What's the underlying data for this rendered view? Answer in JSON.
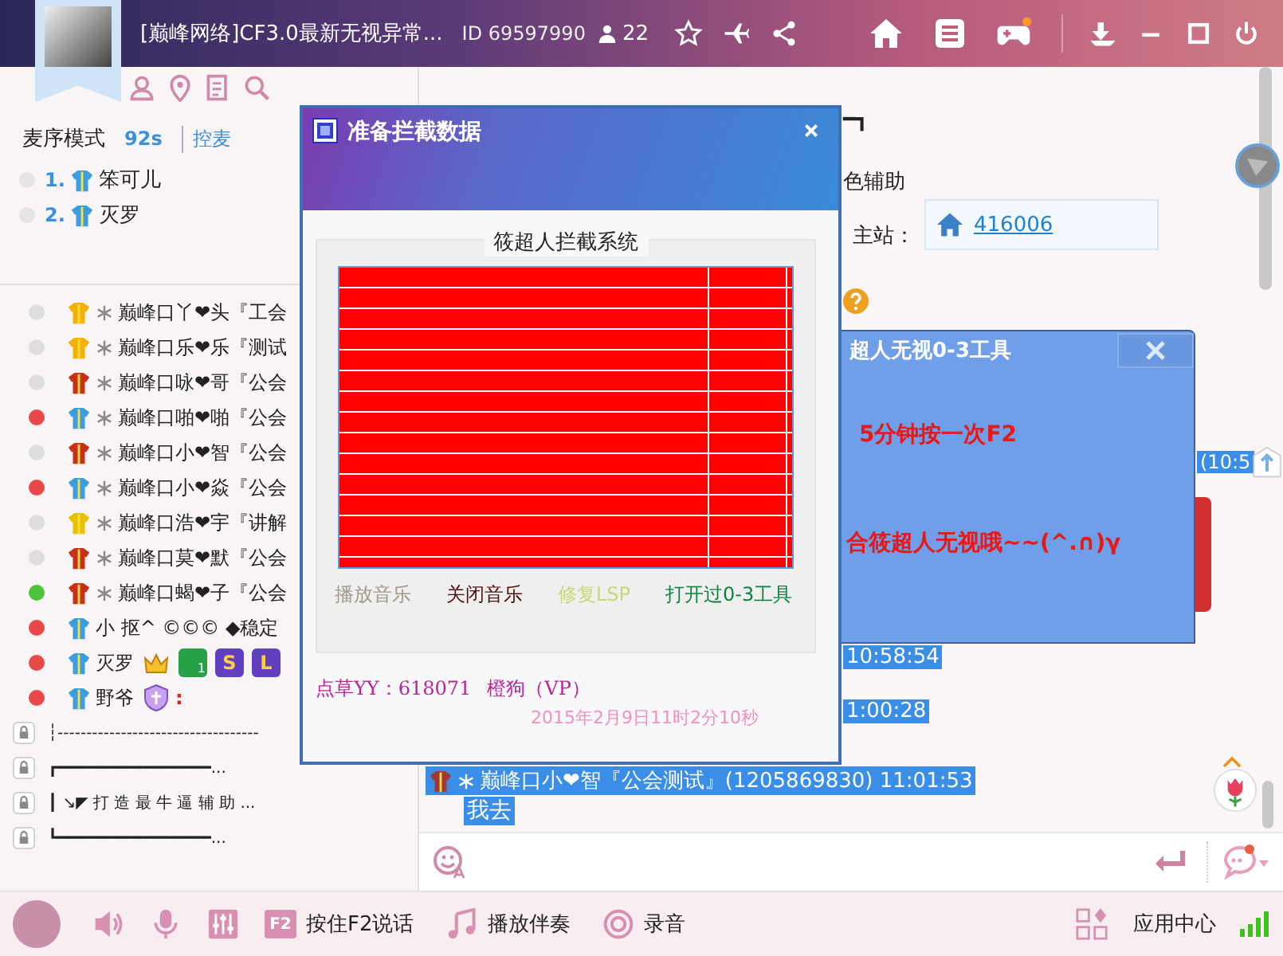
{
  "window": {
    "title": "[巅峰网络]CF3.0最新无视异常...",
    "id": "ID 69597990",
    "online_count": "22",
    "game_notification": true
  },
  "queue": {
    "mode_label": "麦序模式",
    "timer": "92s",
    "control_link": "控麦",
    "entries": [
      {
        "number": "1.",
        "name": "笨可儿",
        "kind": "blue"
      },
      {
        "number": "2.",
        "name": "灭罗",
        "kind": "blue"
      }
    ]
  },
  "members": [
    {
      "color": "#dddddd",
      "kind": "gold",
      "decorated": true,
      "name": "巅峰口丫❤头『工会"
    },
    {
      "color": "#dddddd",
      "kind": "gold",
      "decorated": true,
      "name": "巅峰口乐❤乐『测试"
    },
    {
      "color": "#dddddd",
      "kind": "red",
      "decorated": true,
      "name": "巅峰口咏❤哥『公会"
    },
    {
      "color": "#e84848",
      "kind": "blue",
      "decorated": true,
      "name": "巅峰口啪❤啪『公会"
    },
    {
      "color": "#dddddd",
      "kind": "red",
      "decorated": true,
      "name": "巅峰口小❤智『公会"
    },
    {
      "color": "#e84848",
      "kind": "blue",
      "decorated": true,
      "name": "巅峰口小❤焱『公会"
    },
    {
      "color": "#dddddd",
      "kind": "yellow",
      "decorated": true,
      "name": "巅峰口浩❤宇『讲解"
    },
    {
      "color": "#dddddd",
      "kind": "red",
      "decorated": true,
      "name": "巅峰口莫❤默『公会"
    },
    {
      "color": "#4cc43a",
      "kind": "red",
      "decorated": true,
      "name": "巅峰口蝎❤子『公会"
    },
    {
      "color": "#e84848",
      "kind": "blue",
      "decorated": false,
      "name": "小  抠^ ©©©    ◆稳定"
    },
    {
      "color": "#e84848",
      "kind": "blue",
      "decorated": false,
      "name": "灭罗",
      "badges": [
        {
          "kind": "crown"
        },
        {
          "kind": "game",
          "text": "1"
        },
        {
          "kind": "letter",
          "text": "S"
        },
        {
          "kind": "letter",
          "text": "L"
        }
      ]
    },
    {
      "color": "#e84848",
      "kind": "blue",
      "decorated": false,
      "name": "野爷",
      "badges": [
        {
          "kind": "shield"
        }
      ],
      "suffix": ":"
    }
  ],
  "locked_lines": [
    "┆-----------------------------------",
    "┏━━━━━━━━━━━━━━━━...",
    "┃  ↘◤  打 造 最 牛 逼 辅 助 ...",
    "┗━━━━━━━━━━━━━━━━..."
  ],
  "chat": {
    "corner": "━┓",
    "fragment": "色辅助",
    "site_label": "主站：",
    "site_link": "416006",
    "timestamps": [
      "(10:5",
      "10:58:54",
      "1:00:28"
    ],
    "last_message": {
      "sender": "巅峰口小❤智『公会测试』(1205869830) 11:01:53",
      "text": "我去",
      "kind": "brown"
    }
  },
  "intercept_dialog": {
    "title": "准备拦截数据",
    "group_title": "筱超人拦截系统",
    "buttons": [
      {
        "label": "播放音乐",
        "color": "#a09a8c"
      },
      {
        "label": "关闭音乐",
        "color": "#501010"
      },
      {
        "label": "修复LSP",
        "color": "#c8d878"
      },
      {
        "label": "打开过0-3工具",
        "color": "#108040"
      }
    ],
    "contact": "点草YY：618071",
    "author": "橙狗（VP）",
    "timestamp": "2015年2月9日11时2分10秒"
  },
  "tool_dialog": {
    "title": "超人无视0-3工具",
    "lines": [
      "5分钟按一次F2",
      "合筱超人无视哦~~(^.∩)γ"
    ]
  },
  "bottom_bar": {
    "key_label": "F2",
    "push_to_talk": "按住F2说话",
    "accompaniment": "播放伴奏",
    "record": "录音",
    "app_center": "应用中心"
  }
}
